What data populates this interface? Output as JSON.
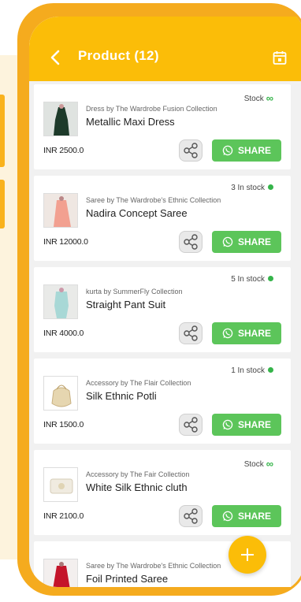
{
  "header": {
    "title": "Product (12)"
  },
  "share_label": "SHARE",
  "colors": {
    "accent": "#fbbd08",
    "whatsapp": "#5cc55a",
    "stock": "#35b44a"
  },
  "products": [
    {
      "subtitle": "Dress by The Wardrobe Fusion Collection",
      "name": "Metallic Maxi Dress",
      "price": "INR 2500.0",
      "stock": "Stock",
      "stock_icon": "infinity"
    },
    {
      "subtitle": "Saree by The Wardrobe's Ethnic Collection",
      "name": "Nadira Concept Saree",
      "price": "INR 12000.0",
      "stock": "3 In stock",
      "stock_icon": "dot"
    },
    {
      "subtitle": "kurta by SummerFly Collection",
      "name": "Straight Pant Suit",
      "price": "INR 4000.0",
      "stock": "5 In stock",
      "stock_icon": "dot"
    },
    {
      "subtitle": "Accessory by The Flair Collection",
      "name": "Silk Ethnic Potli",
      "price": "INR 1500.0",
      "stock": "1 In stock",
      "stock_icon": "dot"
    },
    {
      "subtitle": "Accessory by The Fair Collection",
      "name": "White Silk Ethnic cluth",
      "price": "INR 2100.0",
      "stock": "Stock",
      "stock_icon": "infinity"
    },
    {
      "subtitle": "Saree by The Wardrobe's Ethnic Collection",
      "name": "Foil Printed Saree"
    }
  ]
}
